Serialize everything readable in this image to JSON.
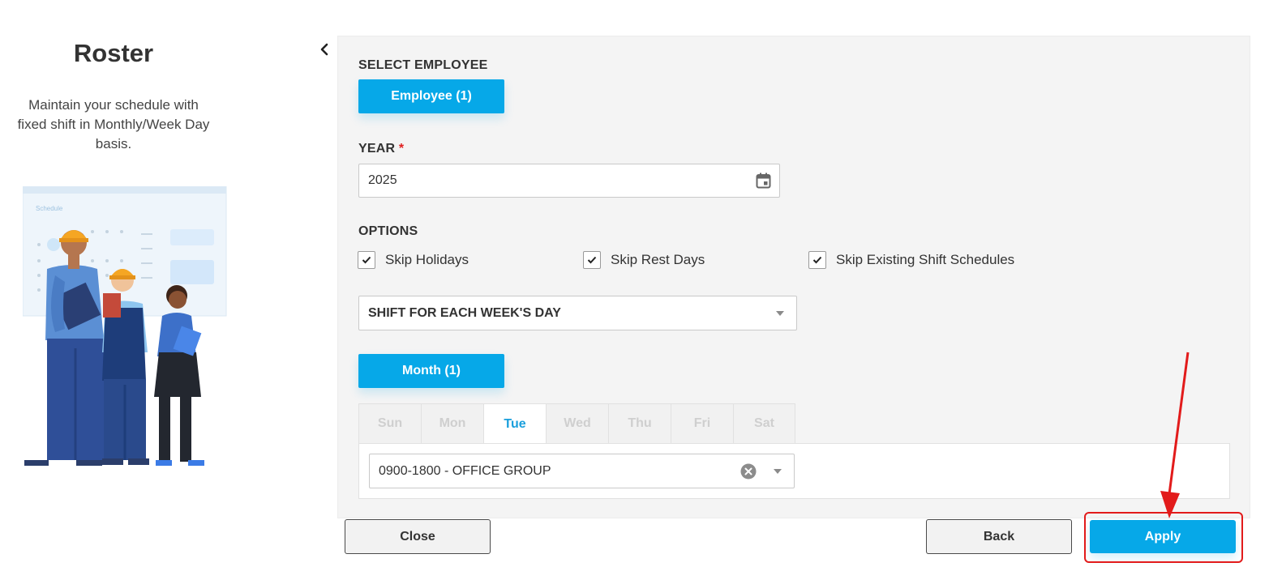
{
  "sidebar": {
    "title": "Roster",
    "description": "Maintain your schedule with fixed shift in Monthly/Week Day basis.",
    "illustration_caption": "Schedule"
  },
  "form": {
    "select_employee_label": "SELECT EMPLOYEE",
    "employee_button": "Employee (1)",
    "year_label": "YEAR",
    "year_required_mark": "*",
    "year_value": "2025",
    "options_label": "OPTIONS",
    "options": [
      {
        "label": "Skip Holidays",
        "checked": true
      },
      {
        "label": "Skip Rest Days",
        "checked": true
      },
      {
        "label": "Skip Existing Shift Schedules",
        "checked": true
      }
    ],
    "shift_mode_value": "SHIFT FOR EACH WEEK'S DAY",
    "month_button": "Month (1)",
    "weekdays": [
      "Sun",
      "Mon",
      "Tue",
      "Wed",
      "Thu",
      "Fri",
      "Sat"
    ],
    "active_weekday": "Tue",
    "shift_value": "0900-1800 - OFFICE GROUP"
  },
  "footer": {
    "close_label": "Close",
    "back_label": "Back",
    "apply_label": "Apply"
  },
  "colors": {
    "primary": "#06a8e8",
    "highlight": "#e21b1b",
    "active_tab_text": "#1a9fdc"
  },
  "icons": {
    "collapse": "chevron-left-icon",
    "calendar": "calendar-icon",
    "check": "check-icon",
    "clear": "clear-circle-icon",
    "dropdown": "caret-down-icon"
  }
}
